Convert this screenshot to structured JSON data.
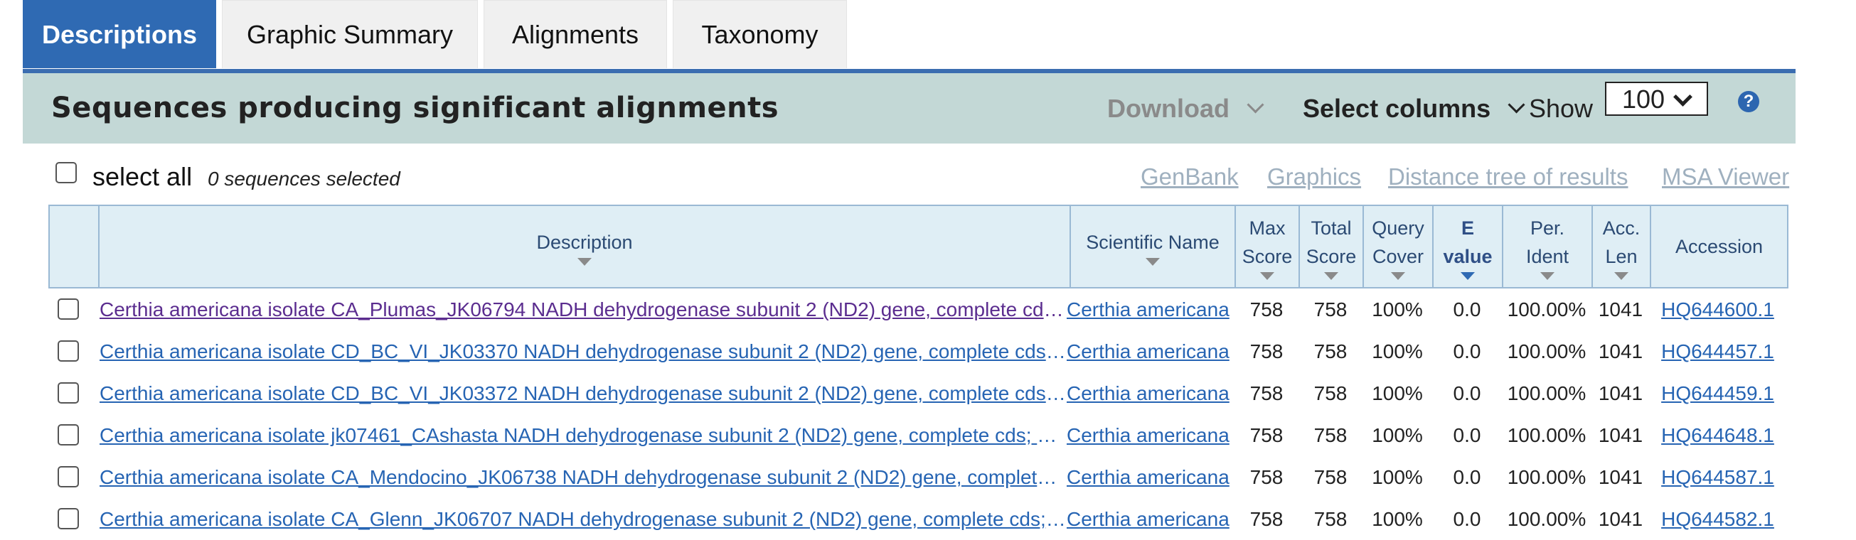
{
  "tabs": [
    {
      "label": "Descriptions",
      "active": true
    },
    {
      "label": "Graphic Summary",
      "active": false
    },
    {
      "label": "Alignments",
      "active": false
    },
    {
      "label": "Taxonomy",
      "active": false
    }
  ],
  "header": {
    "title": "Sequences producing significant alignments",
    "download_label": "Download",
    "select_columns_label": "Select columns",
    "show_label": "Show",
    "show_value": "100",
    "help_icon": "?"
  },
  "selection": {
    "select_all_label": "select all",
    "selected_count_text": "0 sequences selected"
  },
  "tools": {
    "genbank": "GenBank",
    "graphics": "Graphics",
    "distance_tree": "Distance tree of results",
    "msa_viewer": "MSA Viewer"
  },
  "columns": {
    "description": "Description",
    "scientific_name": "Scientific Name",
    "max_score": [
      "Max",
      "Score"
    ],
    "total_score": [
      "Total",
      "Score"
    ],
    "query_cover": [
      "Query",
      "Cover"
    ],
    "e_value": [
      "E",
      "value"
    ],
    "per_ident": [
      "Per.",
      "Ident"
    ],
    "acc_len": [
      "Acc.",
      "Len"
    ],
    "accession": "Accession"
  },
  "rows": [
    {
      "description": "Certhia americana isolate CA_Plumas_JK06794 NADH dehydrogenase subunit 2 (ND2) gene, complete cds; mitochondrial",
      "scientific_name": "Certhia americana",
      "max_score": "758",
      "total_score": "758",
      "query_cover": "100%",
      "e_value": "0.0",
      "per_ident": "100.00%",
      "acc_len": "1041",
      "accession": "HQ644600.1",
      "visited": true
    },
    {
      "description": "Certhia americana isolate CD_BC_VI_JK03370 NADH dehydrogenase subunit 2 (ND2) gene, complete cds; mitochondrial",
      "scientific_name": "Certhia americana",
      "max_score": "758",
      "total_score": "758",
      "query_cover": "100%",
      "e_value": "0.0",
      "per_ident": "100.00%",
      "acc_len": "1041",
      "accession": "HQ644457.1",
      "visited": false
    },
    {
      "description": "Certhia americana isolate CD_BC_VI_JK03372 NADH dehydrogenase subunit 2 (ND2) gene, complete cds; mitochondrial",
      "scientific_name": "Certhia americana",
      "max_score": "758",
      "total_score": "758",
      "query_cover": "100%",
      "e_value": "0.0",
      "per_ident": "100.00%",
      "acc_len": "1041",
      "accession": "HQ644459.1",
      "visited": false
    },
    {
      "description": "Certhia americana isolate jk07461_CAshasta NADH dehydrogenase subunit 2 (ND2) gene, complete cds; mitochondrial",
      "scientific_name": "Certhia americana",
      "max_score": "758",
      "total_score": "758",
      "query_cover": "100%",
      "e_value": "0.0",
      "per_ident": "100.00%",
      "acc_len": "1041",
      "accession": "HQ644648.1",
      "visited": false
    },
    {
      "description": "Certhia americana isolate CA_Mendocino_JK06738 NADH dehydrogenase subunit 2 (ND2) gene, complete cds; mitochondrial",
      "scientific_name": "Certhia americana",
      "max_score": "758",
      "total_score": "758",
      "query_cover": "100%",
      "e_value": "0.0",
      "per_ident": "100.00%",
      "acc_len": "1041",
      "accession": "HQ644587.1",
      "visited": false
    },
    {
      "description": "Certhia americana isolate CA_Glenn_JK06707 NADH dehydrogenase subunit 2 (ND2) gene, complete cds; mitochondrial",
      "scientific_name": "Certhia americana",
      "max_score": "758",
      "total_score": "758",
      "query_cover": "100%",
      "e_value": "0.0",
      "per_ident": "100.00%",
      "acc_len": "1041",
      "accession": "HQ644582.1",
      "visited": false
    }
  ]
}
